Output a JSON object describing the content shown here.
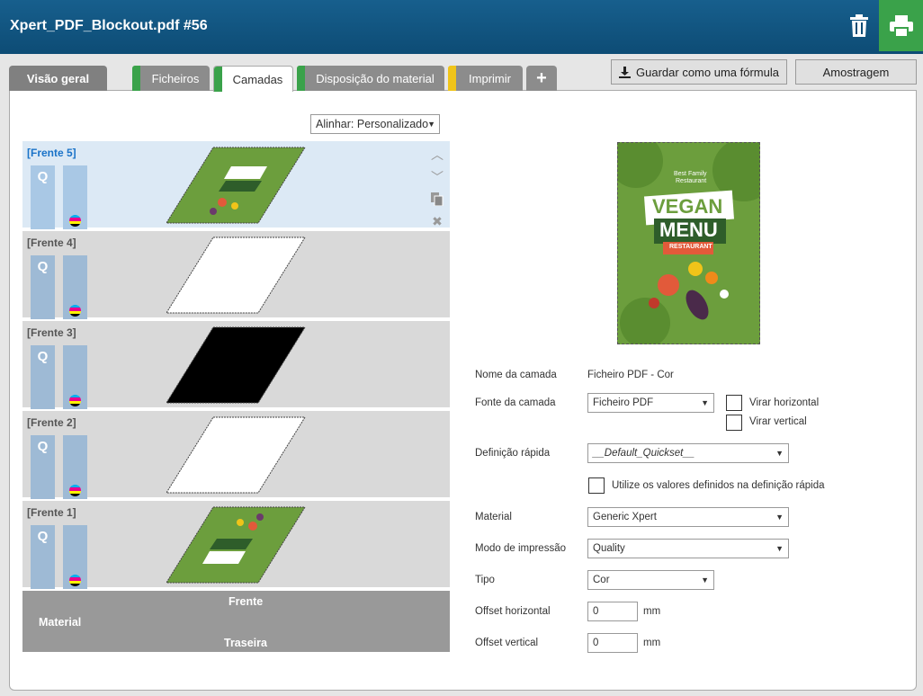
{
  "window": {
    "title": "Xpert_PDF_Blockout.pdf #56"
  },
  "tabs": [
    {
      "label": "Visão geral"
    },
    {
      "label": "Ficheiros",
      "stripe": "#3aa24a"
    },
    {
      "label": "Camadas",
      "stripe": "#3aa24a"
    },
    {
      "label": "Disposição do material",
      "stripe": "#3aa24a"
    },
    {
      "label": "Imprimir",
      "stripe": "#f0c419"
    }
  ],
  "toolbar": {
    "save_formula": "Guardar como uma fórmula",
    "sampling": "Amostragem"
  },
  "align": {
    "value": "Alinhar: Personalizado"
  },
  "layers": [
    {
      "name": "[Frente 5]",
      "q": "Q",
      "thumb": "vegan"
    },
    {
      "name": "[Frente 4]",
      "q": "Q",
      "thumb": "white"
    },
    {
      "name": "[Frente 3]",
      "q": "Q",
      "thumb": "black"
    },
    {
      "name": "[Frente 2]",
      "q": "Q",
      "thumb": "white"
    },
    {
      "name": "[Frente 1]",
      "q": "Q",
      "thumb": "vegan-mirror"
    }
  ],
  "material_bar": {
    "label": "Material",
    "front": "Frente",
    "back": "Traseira"
  },
  "preview": {
    "line1": "Best Family",
    "line2": "Restaurant",
    "word1": "VEGAN",
    "word2": "MENU",
    "ribbon": "RESTAURANT"
  },
  "form": {
    "layer_name_label": "Nome da camada",
    "layer_name_value": "Ficheiro PDF - Cor",
    "layer_source_label": "Fonte da camada",
    "layer_source_value": "Ficheiro PDF",
    "flip_h": "Virar horizontal",
    "flip_v": "Virar vertical",
    "quickset_label": "Definição rápida",
    "quickset_value": "__Default_Quickset__",
    "use_quickset": "Utilize os valores definidos na definição rápida",
    "material_label": "Material",
    "material_value": "Generic Xpert",
    "print_mode_label": "Modo de impressão",
    "print_mode_value": "Quality",
    "type_label": "Tipo",
    "type_value": "Cor",
    "offset_h_label": "Offset horizontal",
    "offset_h_value": "0",
    "offset_v_label": "Offset vertical",
    "offset_v_value": "0",
    "unit": "mm"
  },
  "colors": {
    "titlebar": "#0d4c75",
    "accent_green": "#3aa24a",
    "accent_yellow": "#f0c419",
    "selected_layer": "#dce9f5",
    "selected_text": "#1a73c8"
  },
  "icons": {
    "trash": "trash-icon",
    "print": "printer-icon",
    "download": "download-icon",
    "add": "plus-icon"
  }
}
